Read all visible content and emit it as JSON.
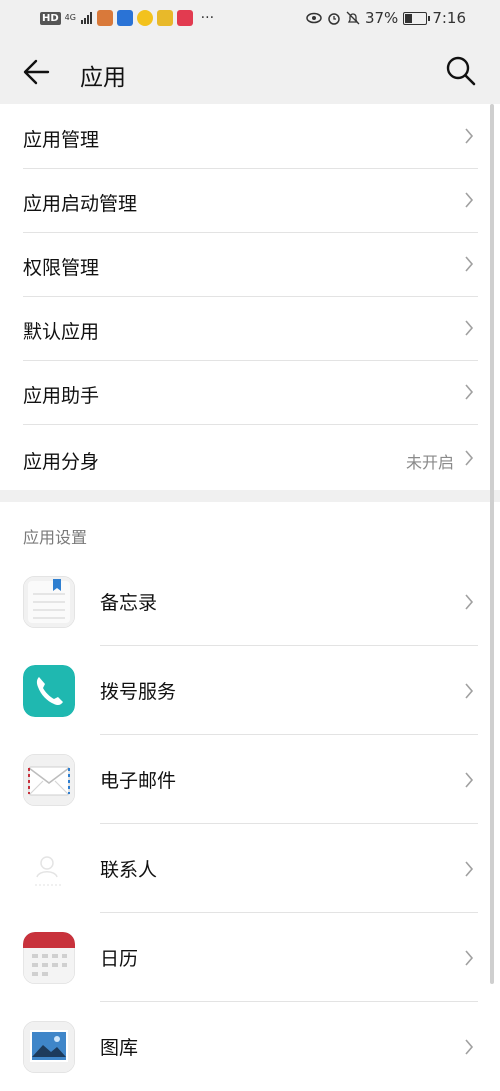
{
  "status_bar": {
    "left_badge": "HD",
    "network": "4G",
    "more": "···",
    "battery": "37%",
    "battery_level": 0.37,
    "time": "7:16"
  },
  "app_bar": {
    "title": "应用"
  },
  "top_menu": [
    {
      "label": "应用管理"
    },
    {
      "label": "应用启动管理"
    },
    {
      "label": "权限管理"
    },
    {
      "label": "默认应用"
    },
    {
      "label": "应用助手"
    },
    {
      "label": "应用分身",
      "value": "未开启"
    }
  ],
  "settings_section": {
    "header": "应用设置",
    "apps": [
      {
        "label": "备忘录",
        "icon": "notepad-icon"
      },
      {
        "label": "拨号服务",
        "icon": "phone-icon"
      },
      {
        "label": "电子邮件",
        "icon": "mail-icon"
      },
      {
        "label": "联系人",
        "icon": "contacts-icon"
      },
      {
        "label": "日历",
        "icon": "calendar-icon"
      },
      {
        "label": "图库",
        "icon": "gallery-icon"
      }
    ]
  },
  "colors": {
    "accent_teal": "#1fb8b0",
    "calendar_red": "#c8323c",
    "note_blue": "#2f7fd0"
  }
}
